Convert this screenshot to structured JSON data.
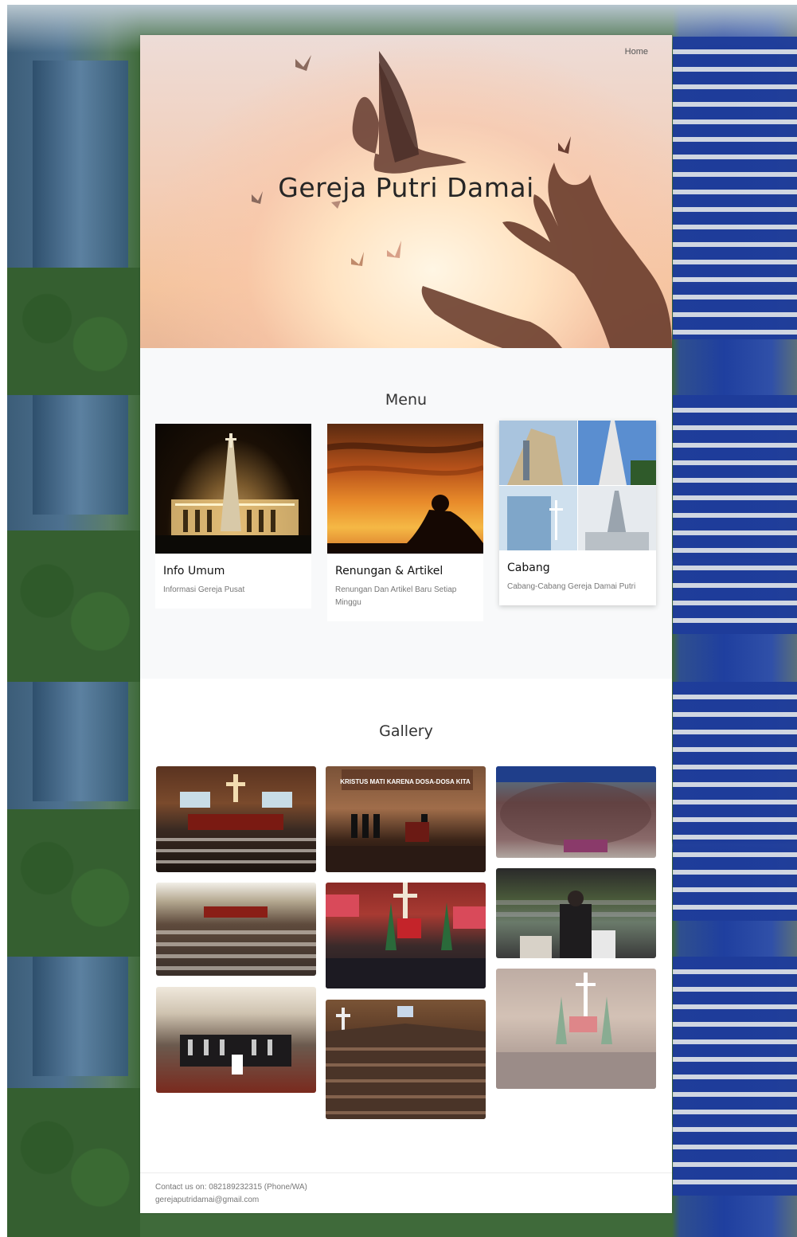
{
  "nav": {
    "home_label": "Home"
  },
  "hero": {
    "title": "Gereja Putri Damai"
  },
  "menu": {
    "heading": "Menu",
    "cards": [
      {
        "title": "Info Umum",
        "description": "Informasi Gereja Pusat"
      },
      {
        "title": "Renungan & Artikel",
        "description": "Renungan Dan Artikel Baru Setiap Minggu"
      },
      {
        "title": "Cabang",
        "description": "Cabang-Cabang Gereja Damai Putri"
      }
    ]
  },
  "gallery": {
    "heading": "Gallery",
    "banner_text": "KRISTUS MATI KARENA DOSA-DOSA KITA"
  },
  "footer": {
    "contact": "Contact us on: 082189232315 (Phone/WA)",
    "email": "gerejaputridamai@gmail.com"
  }
}
